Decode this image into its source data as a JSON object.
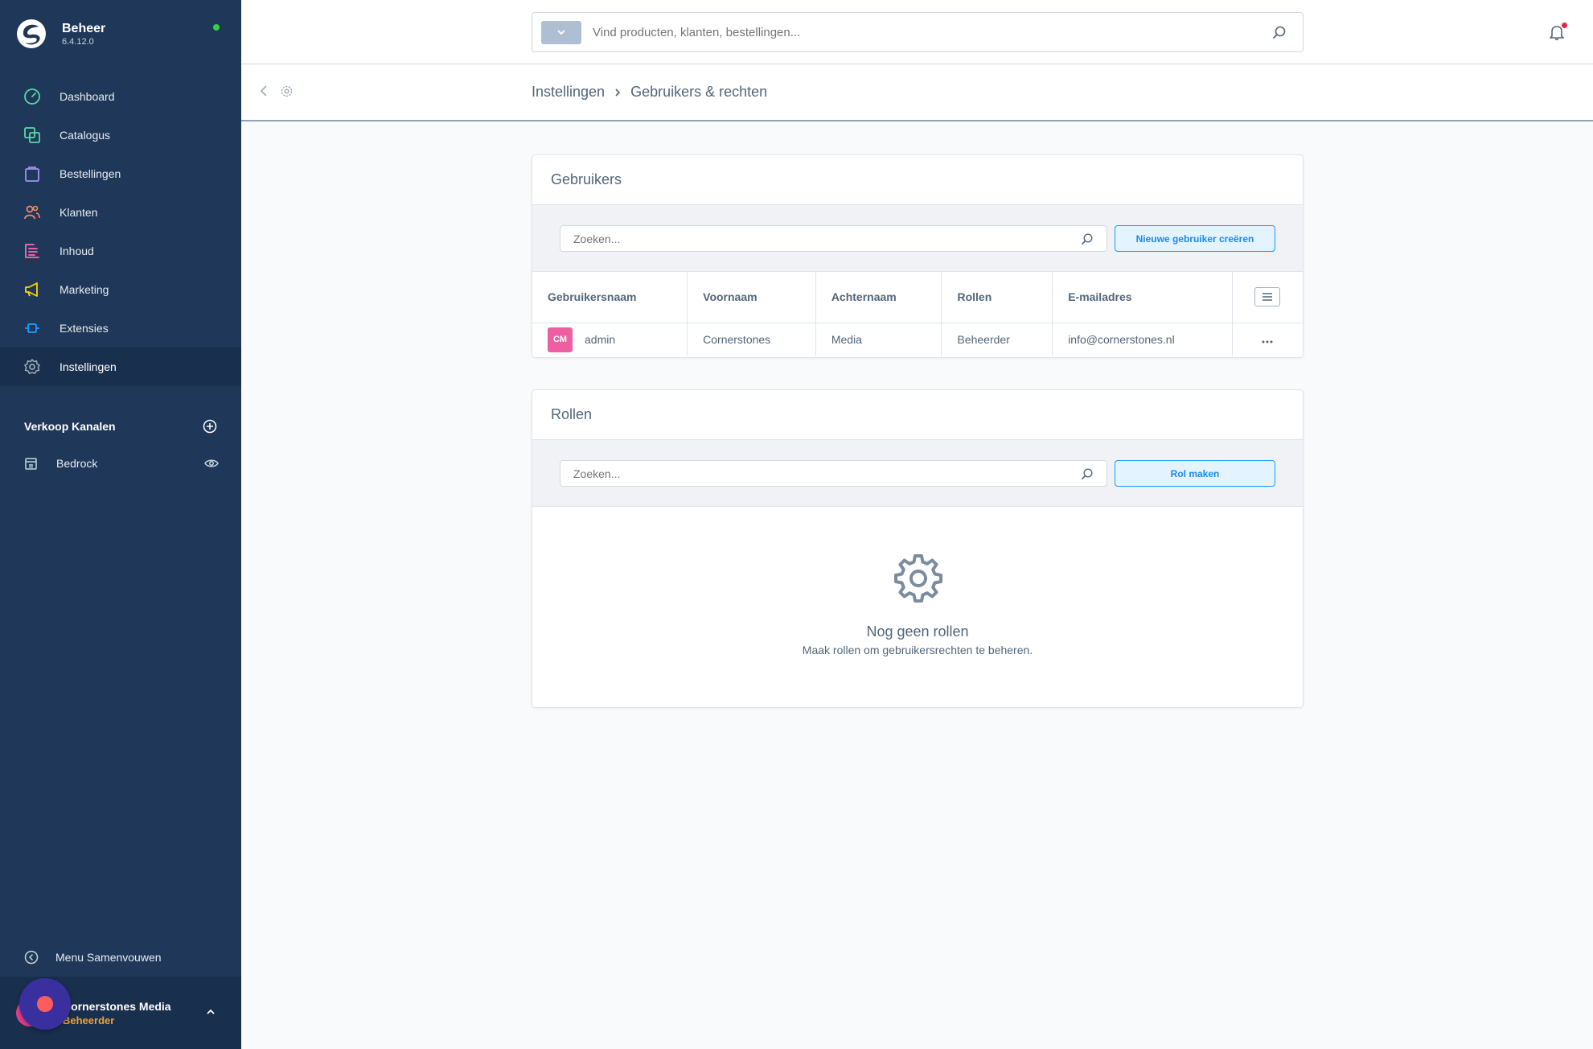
{
  "app": {
    "title": "Beheer",
    "version": "6.4.12.0"
  },
  "sidebar": {
    "items": [
      {
        "label": "Dashboard",
        "icon": "dashboard-icon",
        "color": "#57d9a3"
      },
      {
        "label": "Catalogus",
        "icon": "catalog-icon",
        "color": "#57d9a3"
      },
      {
        "label": "Bestellingen",
        "icon": "orders-icon",
        "color": "#a092f0"
      },
      {
        "label": "Klanten",
        "icon": "customers-icon",
        "color": "#f88962"
      },
      {
        "label": "Inhoud",
        "icon": "content-icon",
        "color": "#ff68b4"
      },
      {
        "label": "Marketing",
        "icon": "marketing-icon",
        "color": "#ffd700"
      },
      {
        "label": "Extensies",
        "icon": "extensions-icon",
        "color": "#189eff"
      },
      {
        "label": "Instellingen",
        "icon": "settings-icon",
        "color": "#9aa8b5"
      }
    ],
    "active_index": 7,
    "channels_title": "Verkoop Kanalen",
    "channels": [
      {
        "label": "Bedrock"
      }
    ],
    "collapse_label": "Menu Samenvouwen",
    "user": {
      "name": "Cornerstones Media",
      "role": "Beheerder"
    }
  },
  "topbar": {
    "search_placeholder": "Vind producten, klanten, bestellingen..."
  },
  "breadcrumb": {
    "parent": "Instellingen",
    "current": "Gebruikers & rechten"
  },
  "users_card": {
    "title": "Gebruikers",
    "search_placeholder": "Zoeken...",
    "button_label": "Nieuwe gebruiker creëren",
    "columns": [
      "Gebruikersnaam",
      "Voornaam",
      "Achternaam",
      "Rollen",
      "E-mailadres"
    ],
    "rows": [
      {
        "avatar_initials": "CM",
        "username": "admin",
        "first_name": "Cornerstones",
        "last_name": "Media",
        "roles": "Beheerder",
        "email": "info@cornerstones.nl"
      }
    ]
  },
  "roles_card": {
    "title": "Rollen",
    "search_placeholder": "Zoeken...",
    "button_label": "Rol maken",
    "empty_title": "Nog geen rollen",
    "empty_text": "Maak rollen om gebruikersrechten te beheren."
  },
  "colors": {
    "sidebar_bg": "#1f3859",
    "accent": "#189eff",
    "avatar_pink": "#ee5fa1",
    "status_online": "#37d046"
  }
}
